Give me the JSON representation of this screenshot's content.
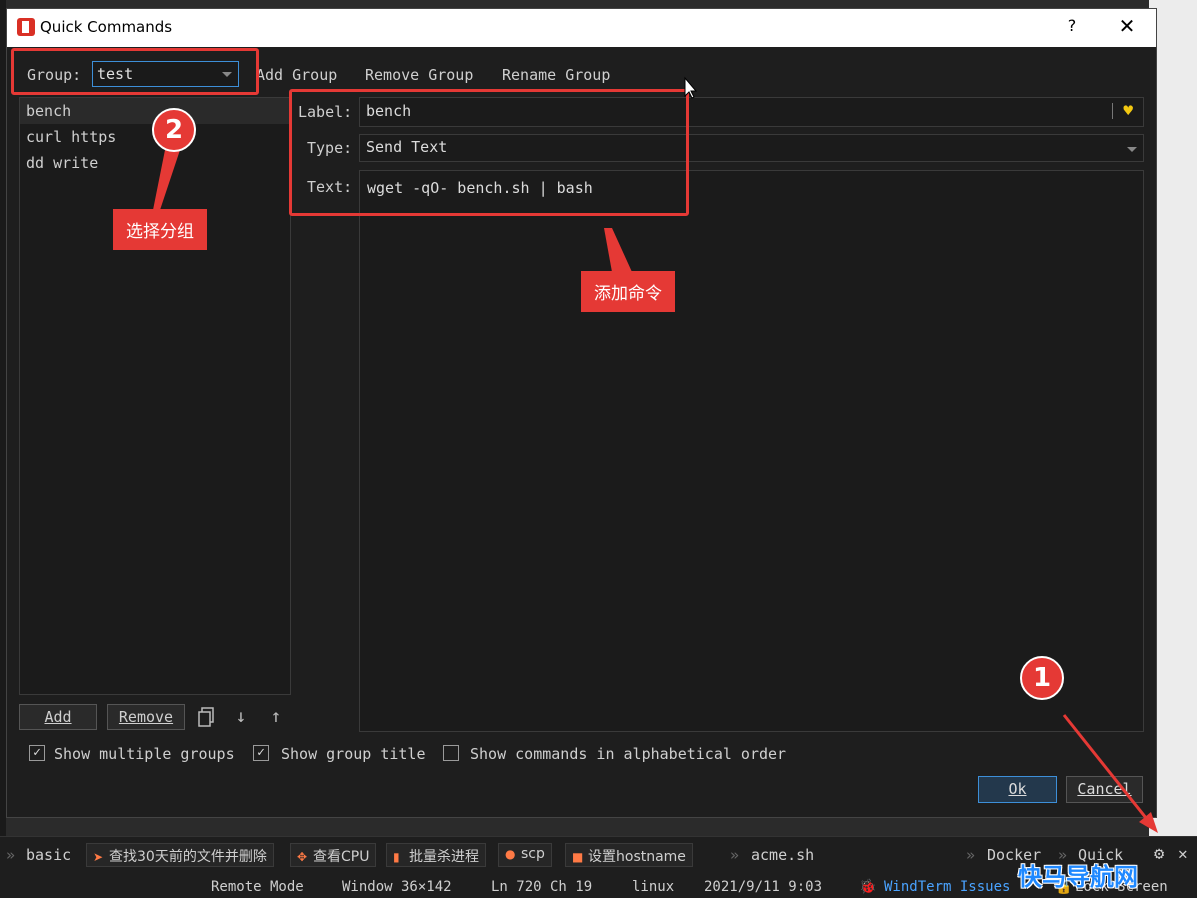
{
  "window": {
    "title": "Quick Commands",
    "help": "?",
    "close": "✕"
  },
  "group": {
    "label": "Group:",
    "value": "test"
  },
  "toolbar": {
    "add_group": "Add Group",
    "remove_group": "Remove Group",
    "rename_group": "Rename Group"
  },
  "commands": [
    "bench",
    "curl https",
    "dd write"
  ],
  "editor": {
    "label_label": "Label:",
    "label_value": "bench",
    "type_label": "Type:",
    "type_value": "Send Text",
    "text_label": "Text:",
    "text_value": "wget -qO- bench.sh | bash"
  },
  "list_buttons": {
    "add": "Add",
    "remove": "Remove"
  },
  "options": [
    {
      "label": "Show multiple groups",
      "checked": true
    },
    {
      "label": "Show group title",
      "checked": true
    },
    {
      "label": "Show commands in alphabetical order",
      "checked": false
    }
  ],
  "dialog_buttons": {
    "ok": "Ok",
    "cancel": "Cancel"
  },
  "annotations": {
    "badge1": "1",
    "badge2": "2",
    "callout_group": "选择分组",
    "callout_command": "添加命令"
  },
  "quickbar": {
    "lead": "basic",
    "items": [
      "查找30天前的文件并删除",
      "查看CPU",
      "批量杀进程",
      "scp",
      "设置hostname"
    ],
    "plain": "acme.sh",
    "right_docker": "Docker",
    "right_quick": "Quick"
  },
  "statusbar": {
    "mode": "Remote Mode",
    "window": "Window 36×142",
    "position": "Ln 720 Ch 19",
    "os": "linux",
    "datetime": "2021/9/11 9:03",
    "issues": "WindTerm Issues",
    "lock": "Lock Screen"
  },
  "watermark": "快马导航网",
  "colors": {
    "accent": "#3d8fd8",
    "annotation_red": "#e53935",
    "heart": "#f2c811"
  }
}
